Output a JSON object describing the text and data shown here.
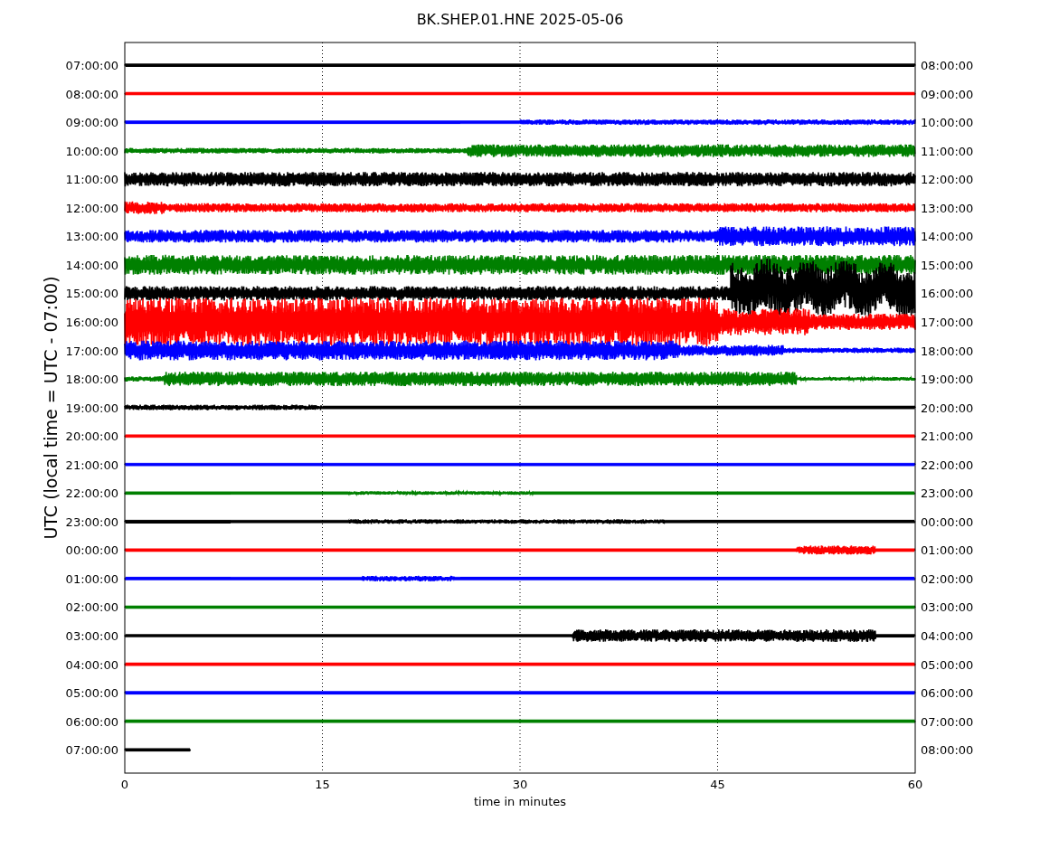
{
  "title": "BK.SHEP.01.HNE 2025-05-06",
  "ylabel": "UTC (local time = UTC - 07:00)",
  "xlabel": "time in minutes",
  "xticks": [
    "0",
    "15",
    "30",
    "45",
    "60"
  ],
  "traces": [
    {
      "left": "07:00:00",
      "right": "08:00:00",
      "color": "#000000"
    },
    {
      "left": "08:00:00",
      "right": "09:00:00",
      "color": "#ff0000"
    },
    {
      "left": "09:00:00",
      "right": "10:00:00",
      "color": "#0000ff"
    },
    {
      "left": "10:00:00",
      "right": "11:00:00",
      "color": "#008000"
    },
    {
      "left": "11:00:00",
      "right": "12:00:00",
      "color": "#000000"
    },
    {
      "left": "12:00:00",
      "right": "13:00:00",
      "color": "#ff0000"
    },
    {
      "left": "13:00:00",
      "right": "14:00:00",
      "color": "#0000ff"
    },
    {
      "left": "14:00:00",
      "right": "15:00:00",
      "color": "#008000"
    },
    {
      "left": "15:00:00",
      "right": "16:00:00",
      "color": "#000000"
    },
    {
      "left": "16:00:00",
      "right": "17:00:00",
      "color": "#ff0000"
    },
    {
      "left": "17:00:00",
      "right": "18:00:00",
      "color": "#0000ff"
    },
    {
      "left": "18:00:00",
      "right": "19:00:00",
      "color": "#008000"
    },
    {
      "left": "19:00:00",
      "right": "20:00:00",
      "color": "#000000"
    },
    {
      "left": "20:00:00",
      "right": "21:00:00",
      "color": "#ff0000"
    },
    {
      "left": "21:00:00",
      "right": "22:00:00",
      "color": "#0000ff"
    },
    {
      "left": "22:00:00",
      "right": "23:00:00",
      "color": "#008000"
    },
    {
      "left": "23:00:00",
      "right": "00:00:00",
      "color": "#000000"
    },
    {
      "left": "00:00:00",
      "right": "01:00:00",
      "color": "#ff0000"
    },
    {
      "left": "01:00:00",
      "right": "02:00:00",
      "color": "#0000ff"
    },
    {
      "left": "02:00:00",
      "right": "03:00:00",
      "color": "#008000"
    },
    {
      "left": "03:00:00",
      "right": "04:00:00",
      "color": "#000000"
    },
    {
      "left": "04:00:00",
      "right": "05:00:00",
      "color": "#ff0000"
    },
    {
      "left": "05:00:00",
      "right": "06:00:00",
      "color": "#0000ff"
    },
    {
      "left": "06:00:00",
      "right": "07:00:00",
      "color": "#008000"
    },
    {
      "left": "07:00:00",
      "right": "08:00:00",
      "color": "#000000"
    }
  ]
}
